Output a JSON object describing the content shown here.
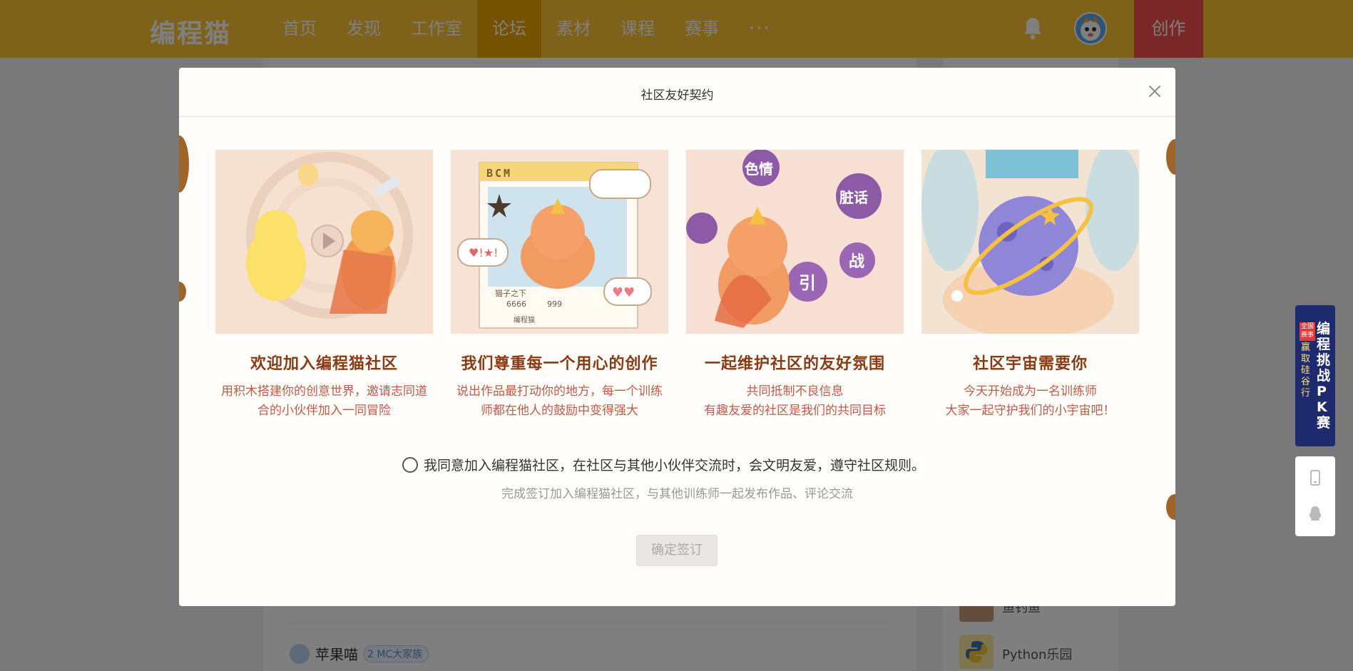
{
  "header": {
    "logo": "编程猫",
    "nav": [
      "首页",
      "发现",
      "工作室",
      "论坛",
      "素材",
      "课程",
      "赛事"
    ],
    "more": "···",
    "create_label": "创作"
  },
  "background": {
    "post_user": "苹果喵",
    "post_badge": "MC大家族",
    "badge_num": "2",
    "side_item1": "鱼钓鱼",
    "side_item2": "Python乐园"
  },
  "ad": {
    "title": "编程挑战PK赛",
    "subtitle": "赢取硅谷行",
    "tag": "全国赛事"
  },
  "modal": {
    "title": "社区友好契约",
    "cards": [
      {
        "title": "欢迎加入编程猫社区",
        "desc": [
          "用积木搭建你的创意世界，邀请志同道",
          "合的小伙伴加入一同冒险"
        ]
      },
      {
        "title": "我们尊重每一个用心的创作",
        "desc": [
          "说出作品最打动你的地方，每一个训练",
          "师都在他人的鼓励中变得强大"
        ]
      },
      {
        "title": "一起维护社区的友好氛围",
        "desc": [
          "共同抵制不良信息",
          "有趣友爱的社区是我们的共同目标"
        ]
      },
      {
        "title": "社区宇宙需要你",
        "desc": [
          "今天开始成为一名训练师",
          "大家一起守护我们的小宇宙吧！"
        ]
      }
    ],
    "card2_art": {
      "brand": "BCM",
      "author": "猫子之下",
      "views": "6666",
      "likes": "999",
      "footer": "编程猫"
    },
    "card3_art": {
      "bubbles": [
        "色情",
        "脏话",
        "引",
        "战"
      ]
    },
    "agree_text": "我同意加入编程猫社区，在社区与其他小伙伴交流时，会文明友爱，遵守社区规则。",
    "agree_sub": "完成签订加入编程猫社区，与其他训练师一起发布作品、评论交流",
    "confirm_label": "确定签订"
  },
  "colors": {
    "nav_bg": "#fec433",
    "nav_active": "#e9a400",
    "create_bg": "#f44f4f",
    "card_title": "#8a3a12",
    "card_desc": "#c05a4a"
  }
}
